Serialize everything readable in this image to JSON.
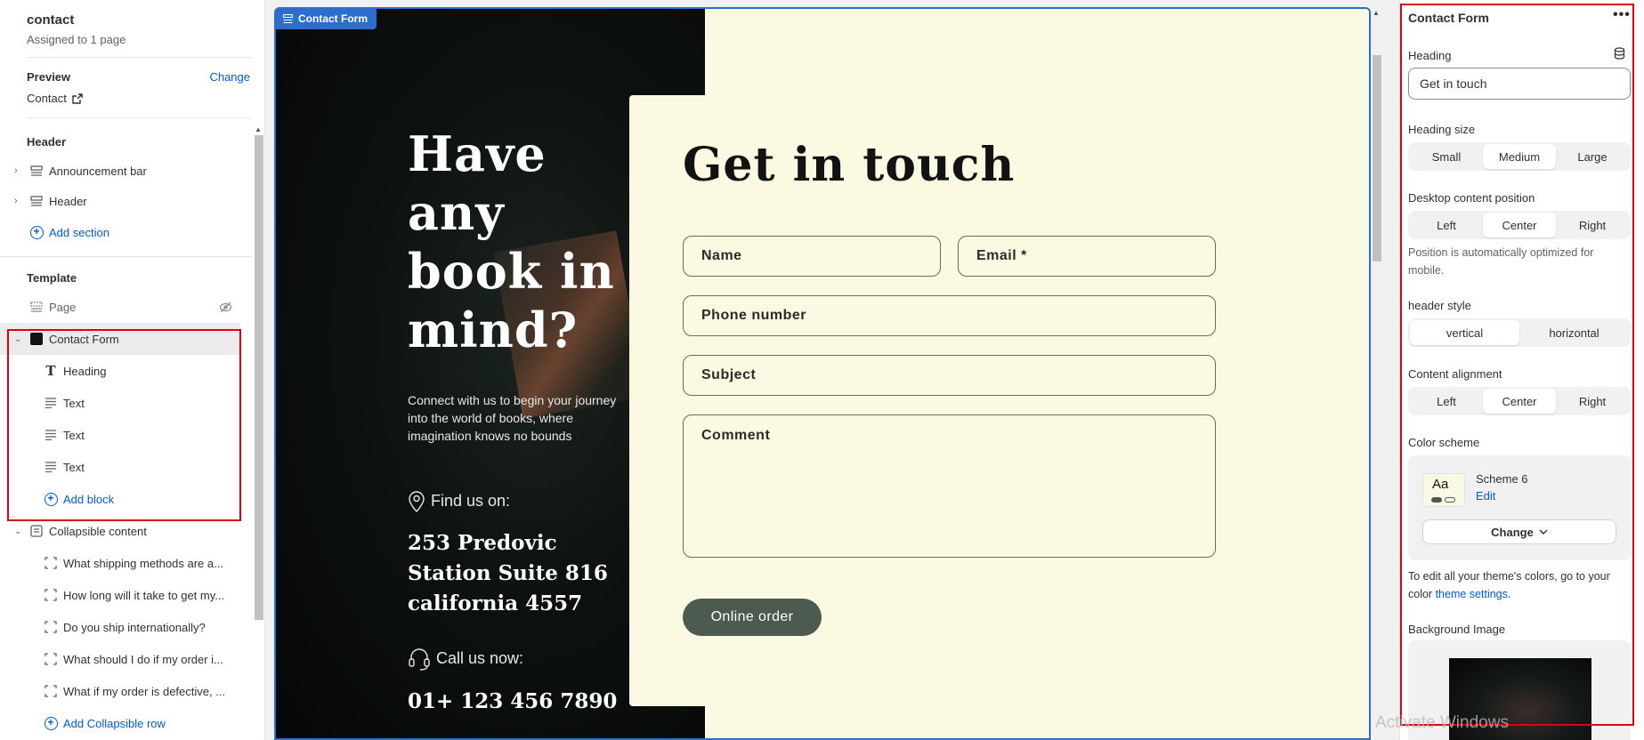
{
  "sidebar": {
    "page_name": "contact",
    "assigned": "Assigned to 1 page",
    "preview_label": "Preview",
    "change_label": "Change",
    "preview_value": "Contact",
    "header_group": "Header",
    "header_items": [
      {
        "label": "Announcement bar"
      },
      {
        "label": "Header"
      }
    ],
    "add_section": "Add section",
    "template_group": "Template",
    "page_item": "Page",
    "contact_form": "Contact Form",
    "contact_blocks": [
      {
        "label": "Heading",
        "icon": "text-icon"
      },
      {
        "label": "Text",
        "icon": "paragraph-icon"
      },
      {
        "label": "Text",
        "icon": "paragraph-icon"
      },
      {
        "label": "Text",
        "icon": "paragraph-icon"
      }
    ],
    "add_block": "Add block",
    "collapsible": "Collapsible content",
    "collapsible_rows": [
      {
        "label": "What shipping methods are a..."
      },
      {
        "label": "How long will it take to get my..."
      },
      {
        "label": "Do you ship internationally?"
      },
      {
        "label": "What should I do if my order i..."
      },
      {
        "label": "What if my order is defective, ..."
      }
    ],
    "add_collapsible_row": "Add Collapsible row"
  },
  "canvas": {
    "tag": "Contact Form",
    "hero_title": "Have any book in mind?",
    "hero_desc": "Connect with us to begin your journey into the world of books, where imagination knows no bounds",
    "find_label": "Find us on:",
    "address": "253 Predovic Station Suite 816 california 4557",
    "call_label": "Call us now:",
    "phone": "01+ 123 456 7890",
    "form_title": "Get in touch",
    "fields": {
      "name": "Name",
      "email": "Email *",
      "phone": "Phone number",
      "subject": "Subject",
      "comment": "Comment"
    },
    "submit": "Online order"
  },
  "settings": {
    "title": "Contact Form",
    "more": "•••",
    "heading_label": "Heading",
    "heading_value": "Get in touch",
    "heading_size_label": "Heading size",
    "heading_size_options": [
      "Small",
      "Medium",
      "Large"
    ],
    "heading_size_selected": "Medium",
    "desktop_pos_label": "Desktop content position",
    "desktop_pos_options": [
      "Left",
      "Center",
      "Right"
    ],
    "desktop_pos_selected": "Center",
    "desktop_pos_help": "Position is automatically optimized for mobile.",
    "header_style_label": "header style",
    "header_style_options": [
      "vertical",
      "horizontal"
    ],
    "header_style_selected": "vertical",
    "content_align_label": "Content alignment",
    "content_align_options": [
      "Left",
      "Center",
      "Right"
    ],
    "content_align_selected": "Center",
    "color_scheme_label": "Color scheme",
    "scheme_swatch_text": "Aa",
    "scheme_name": "Scheme 6",
    "scheme_edit": "Edit",
    "scheme_change": "Change",
    "theme_help_prefix": "To edit all your theme's colors, go to your color ",
    "theme_help_link": "theme settings",
    "theme_help_suffix": ".",
    "bg_image_label": "Background Image"
  },
  "watermark": "Activate Windows",
  "colors": {
    "accent_blue": "#2c6ecb",
    "link_blue": "#005bd3",
    "highlight_red": "#e0000f",
    "form_bg": "#fbf9e1",
    "button_green": "#4c5a50"
  }
}
